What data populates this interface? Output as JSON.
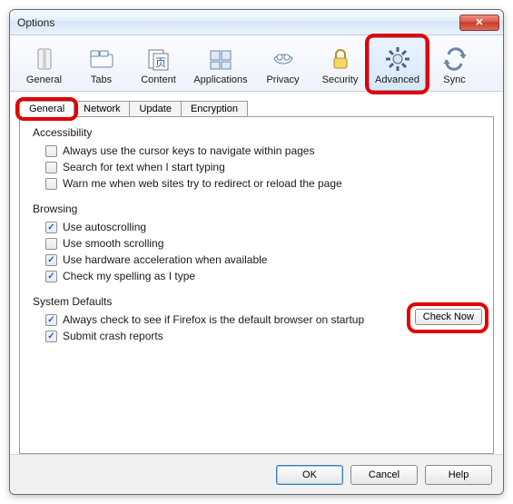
{
  "window": {
    "title": "Options"
  },
  "toolbar": {
    "items": [
      {
        "label": "General"
      },
      {
        "label": "Tabs"
      },
      {
        "label": "Content"
      },
      {
        "label": "Applications"
      },
      {
        "label": "Privacy"
      },
      {
        "label": "Security"
      },
      {
        "label": "Advanced"
      },
      {
        "label": "Sync"
      }
    ]
  },
  "subtabs": {
    "items": [
      {
        "label": "General"
      },
      {
        "label": "Network"
      },
      {
        "label": "Update"
      },
      {
        "label": "Encryption"
      }
    ]
  },
  "groups": {
    "accessibility": {
      "label": "Accessibility",
      "opt0": "Always use the cursor keys to navigate within pages",
      "opt1": "Search for text when I start typing",
      "opt2": "Warn me when web sites try to redirect or reload the page"
    },
    "browsing": {
      "label": "Browsing",
      "opt0": "Use autoscrolling",
      "opt1": "Use smooth scrolling",
      "opt2": "Use hardware acceleration when available",
      "opt3": "Check my spelling as I type"
    },
    "system": {
      "label": "System Defaults",
      "opt0": "Always check to see if Firefox is the default browser on startup",
      "opt1": "Submit crash reports",
      "check_now": "Check Now"
    }
  },
  "footer": {
    "ok": "OK",
    "cancel": "Cancel",
    "help": "Help"
  }
}
